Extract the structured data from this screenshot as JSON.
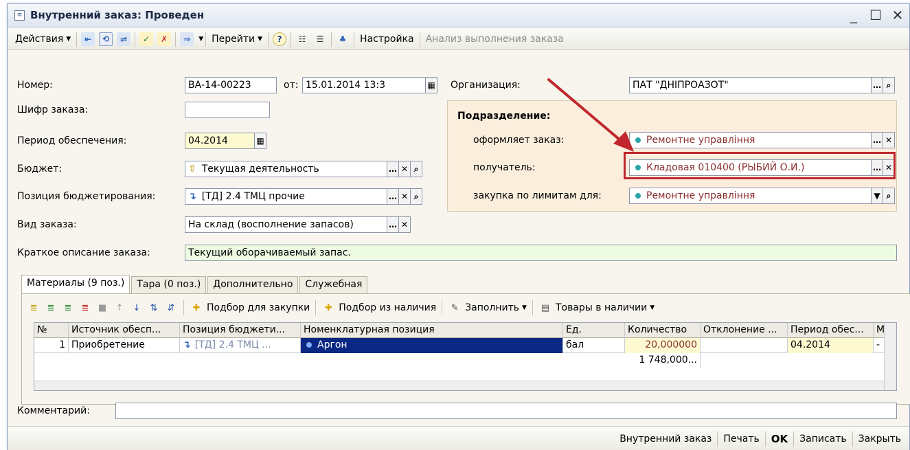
{
  "window": {
    "title": "Внутренний заказ: Проведен"
  },
  "toolbar": {
    "actions": "Действия",
    "goto": "Перейти",
    "help": "?",
    "settings": "Настройка",
    "analysis": "Анализ выполнения заказа"
  },
  "form": {
    "number_label": "Номер:",
    "number_value": "ВА-14-00223",
    "date_label": "от:",
    "date_value": "15.01.2014 13:3",
    "cipher_label": "Шифр заказа:",
    "cipher_value": "",
    "period_label": "Период обеспечения:",
    "period_value": "04.2014",
    "budget_label": "Бюджет:",
    "budget_value": "Текущая деятельность",
    "budget_position_label": "Позиция бюджетирования:",
    "budget_position_value": "[ТД] 2.4 ТМЦ прочие",
    "order_type_label": "Вид заказа:",
    "order_type_value": "На склад (восполнение запасов)",
    "description_label": "Краткое описание заказа:",
    "description_value": "Текущий оборачиваемый запас.",
    "org_label": "Организация:",
    "org_value": "ПАТ \"ДНІПРОАЗОТ\"",
    "comment_label": "Комментарий:",
    "comment_value": ""
  },
  "division": {
    "heading": "Подразделение:",
    "issuer_label": "оформляет заказ:",
    "issuer_value": "Ремонтне управління",
    "recipient_label": "получатель:",
    "recipient_value": "Кладовая 010400 (РЫБИЙ О.И.)",
    "limits_label": "закупка по лимитам для:",
    "limits_value": "Ремонтне управління"
  },
  "tabs": [
    {
      "label": "Материалы (9 поз.)"
    },
    {
      "label": "Тара (0 поз.)"
    },
    {
      "label": "Дополнительно"
    },
    {
      "label": "Служебная"
    }
  ],
  "subtoolbar": {
    "pick_purchase": "Подбор для закупки",
    "pick_stock": "Подбор из наличия",
    "fill": "Заполнить",
    "goods_in_stock": "Товары в наличии"
  },
  "grid": {
    "columns": [
      "№",
      "Источник обесп...",
      "Позиция бюджети...",
      "Номенклатурная позиция",
      "Ед.",
      "Количество",
      "Отклонение ...",
      "Период обес...",
      "М"
    ],
    "rows": [
      [
        "1",
        "Приобретение",
        "[ТД] 2.4 ТМЦ ...",
        "Аргон",
        "бал",
        "20,000000",
        "",
        "04.2014",
        "-"
      ]
    ],
    "total_quantity": "1 748,000..."
  },
  "footer": {
    "internal_order": "Внутренний заказ",
    "print": "Печать",
    "ok": "OK",
    "save": "Записать",
    "close": "Закрыть"
  },
  "colors": {
    "highlight": "#c0272d",
    "accent_dot": "#2aa6a6",
    "panel": "#fbeedd"
  }
}
